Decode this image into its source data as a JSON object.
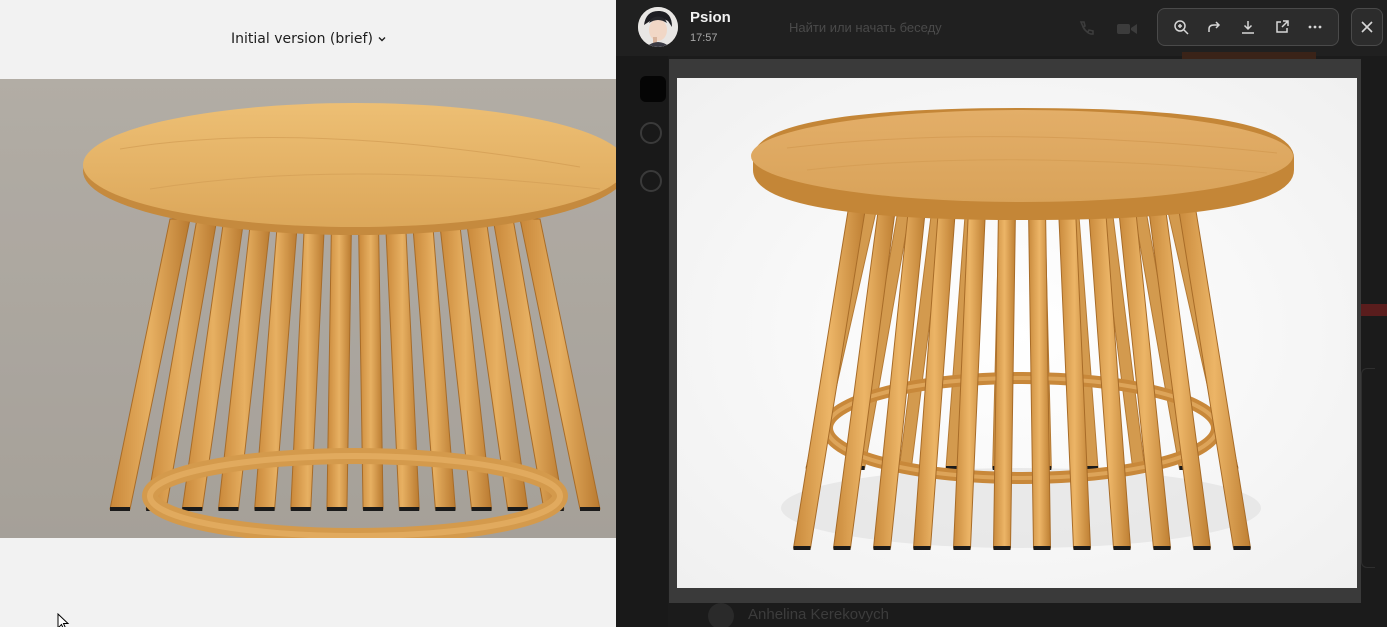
{
  "left_page": {
    "version_selector": "Initial version (brief)",
    "chevron_icon": "chevron-down-icon"
  },
  "chat": {
    "search_placeholder": "Найти или начать беседу",
    "background_contact": "Anhelina Kerekovych",
    "icons": [
      "phone-call-icon",
      "video-camera-icon"
    ]
  },
  "viewer": {
    "user_name": "Psion",
    "timestamp": "17:57",
    "toolbar": [
      "zoom-in-icon",
      "forward-icon",
      "download-icon",
      "open-external-icon",
      "more-icon"
    ],
    "close_icon": "close-icon"
  },
  "colors": {
    "viewer_bg": "#1b1b1b",
    "toolbar_bg": "#2c2c2c",
    "wood": "#e0a95a",
    "page_bg": "#f2f2f2"
  }
}
